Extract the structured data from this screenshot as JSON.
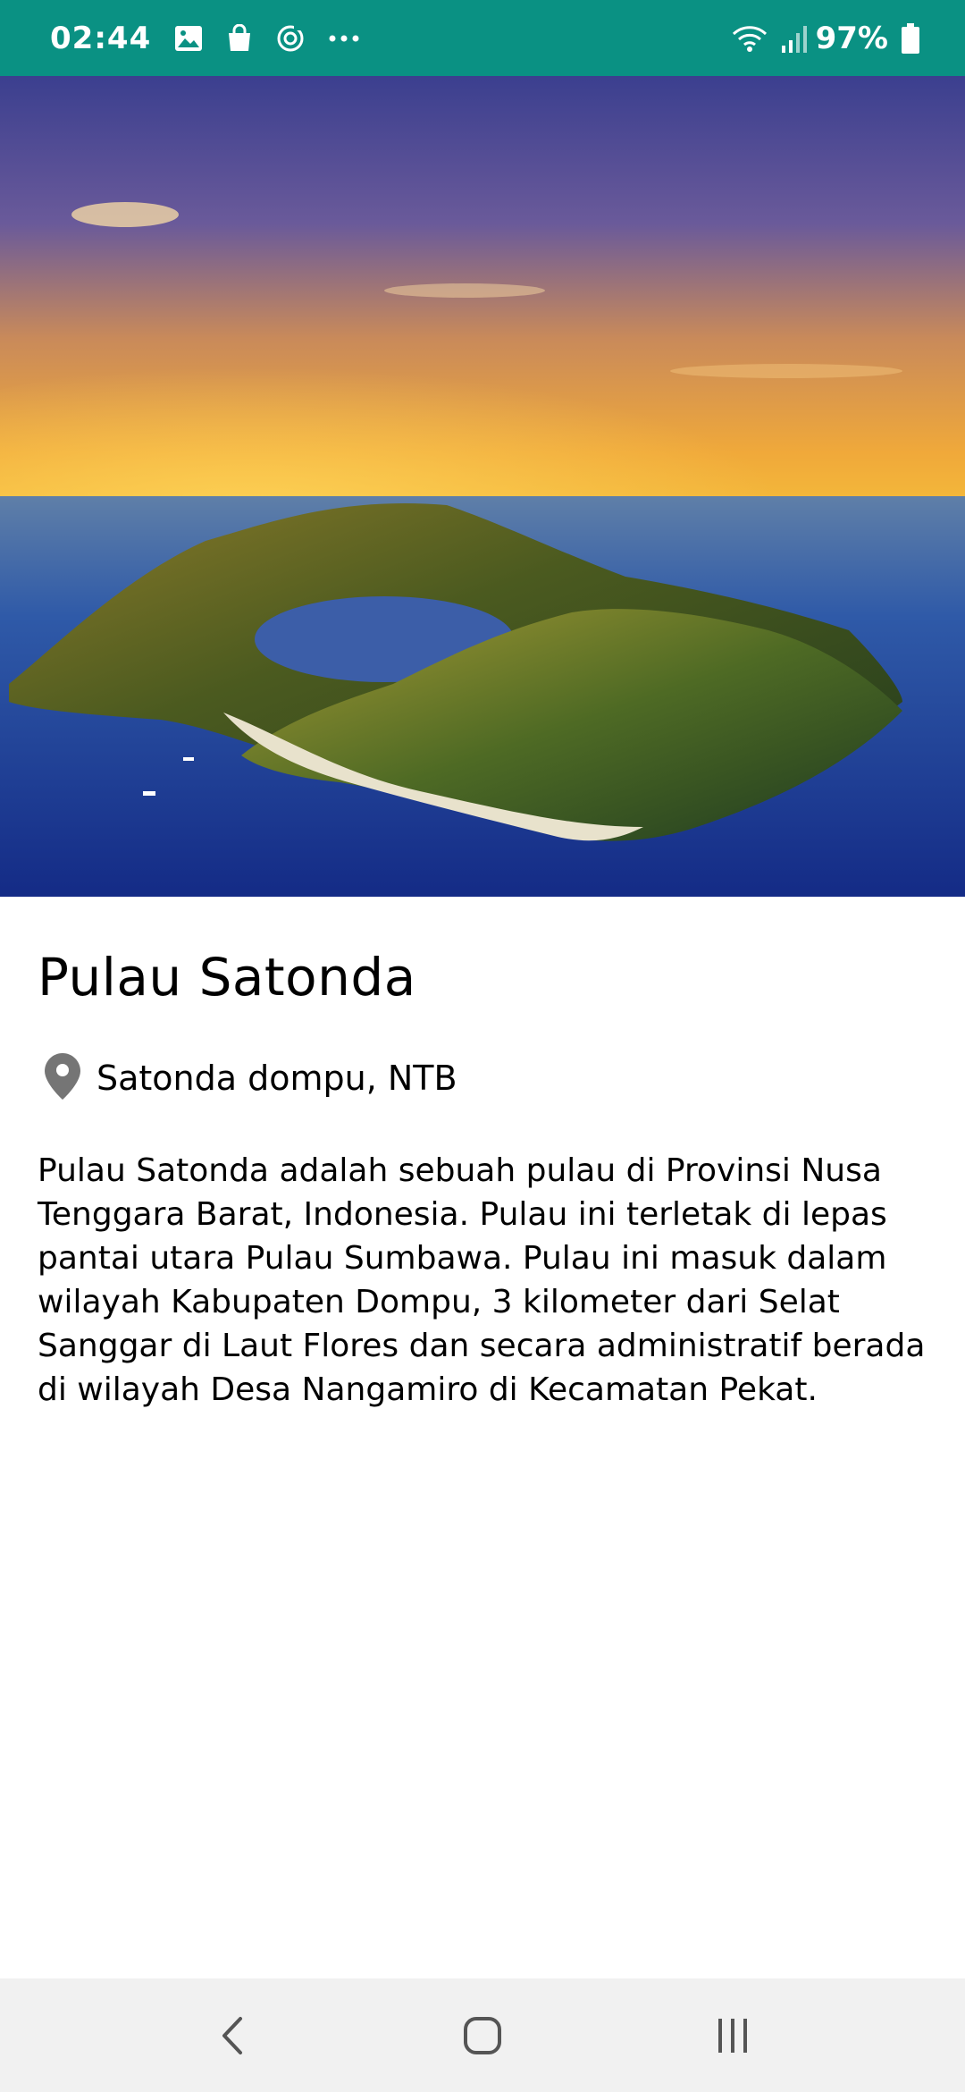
{
  "status_bar": {
    "time": "02:44",
    "battery": "97%",
    "icons": [
      "gallery-icon",
      "bag-icon",
      "sync-icon",
      "more-icon",
      "wifi-icon",
      "signal-icon",
      "battery-icon"
    ],
    "background": "#0a9183"
  },
  "hero": {
    "image": "island-aerial-photo"
  },
  "place": {
    "title": "Pulau Satonda",
    "location": "Satonda dompu, NTB",
    "description": "Pulau Satonda adalah sebuah pulau di Provinsi Nusa Tenggara Barat, Indonesia. Pulau ini terletak di lepas pantai utara Pulau Sumbawa. Pulau ini masuk dalam wilayah Kabupaten Dompu, 3 kilometer dari Selat Sanggar di Laut Flores dan secara administratif berada di wilayah Desa Nangamiro di Kecamatan Pekat."
  },
  "nav_bar": {
    "buttons": [
      "back",
      "home",
      "recents"
    ]
  }
}
